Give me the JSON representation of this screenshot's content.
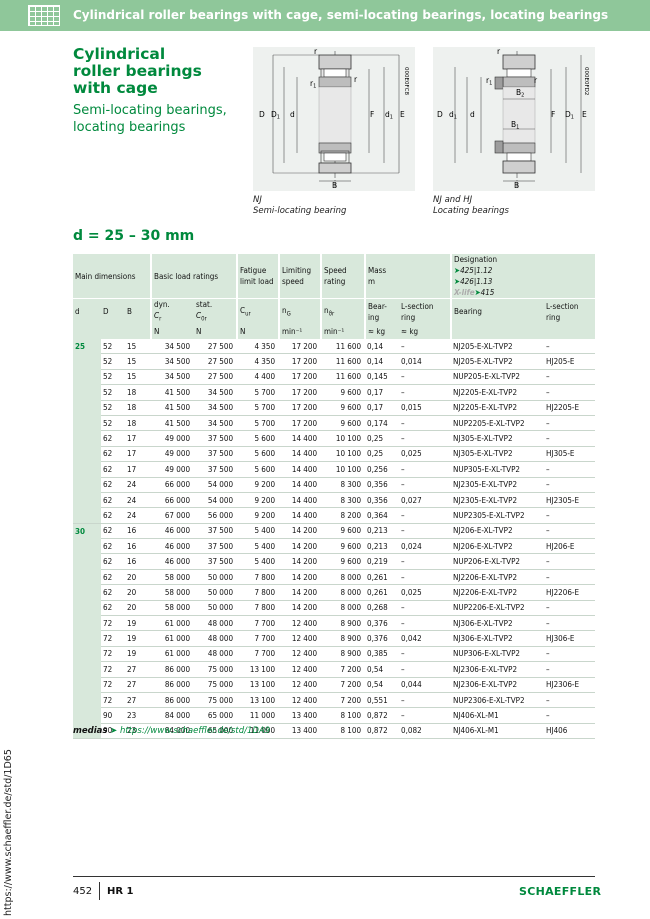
{
  "header": {
    "title": "Cylindrical roller bearings with cage, semi-locating bearings, locating bearings"
  },
  "title": "Cylindrical roller bearings with cage",
  "title_lines": [
    "Cylindrical",
    "roller bearings",
    "with cage"
  ],
  "subtitle_lines": [
    "Semi-locating bearings,",
    "locating bearings"
  ],
  "figures": [
    {
      "code": "000E0FC8",
      "caption_type": "NJ",
      "caption_desc": "Semi-locating bearing",
      "labels": {
        "r_top": "r",
        "r1": "r1",
        "r_right": "r",
        "D": "D",
        "D1": "D1",
        "d": "d",
        "F": "F",
        "d1": "d1",
        "E": "E",
        "B": "B"
      }
    },
    {
      "code": "000E0FD2",
      "caption_type": "NJ and HJ",
      "caption_desc": "Locating bearings",
      "labels": {
        "r_top": "r",
        "r1": "r1",
        "r_right": "r",
        "B2": "B2",
        "B1": "B1",
        "D": "D",
        "d1": "d1",
        "d": "d",
        "F": "F",
        "D1": "D1",
        "E": "E",
        "B": "B"
      }
    }
  ],
  "section_title": "d = 25 – 30 mm",
  "table": {
    "groups": {
      "main_dimensions": "Main dimensions",
      "basic_load": "Basic load ratings",
      "fatigue": "Fatigue limit load",
      "limiting": "Limiting speed",
      "speed_rating": "Speed rating",
      "mass": "Mass",
      "mass_sub": "m",
      "designation": "Designation",
      "desig_425": "425",
      "desig_425b": "1.12",
      "desig_426": "426",
      "desig_426b": "1.13",
      "xlife": "X-life",
      "desig_415": "415"
    },
    "subheaders": {
      "d": "d",
      "D": "D",
      "B": "B",
      "dyn": "dyn.",
      "dyn_sym": "Cr",
      "stat": "stat.",
      "stat_sym": "C0r",
      "cur": "Cur",
      "ng": "nG",
      "nb": "nϑr",
      "bearing_mass": "Bear-ing",
      "lsection_mass": "L-section ring",
      "bearing": "Bearing",
      "lsection": "L-section ring"
    },
    "units": {
      "N1": "N",
      "N2": "N",
      "N3": "N",
      "min1": "min⁻¹",
      "min2": "min⁻¹",
      "kg1": "≈ kg",
      "kg2": "≈ kg"
    },
    "rows": [
      {
        "d": "25",
        "D": "52",
        "B": "15",
        "Cr": "34 500",
        "C0r": "27 500",
        "Cur": "4 350",
        "nG": "17 200",
        "nr": "11 600",
        "m_b": "0,14",
        "m_l": "–",
        "bearing": "NJ205-E-XL-TVP2",
        "ring": "–"
      },
      {
        "d": "",
        "D": "52",
        "B": "15",
        "Cr": "34 500",
        "C0r": "27 500",
        "Cur": "4 350",
        "nG": "17 200",
        "nr": "11 600",
        "m_b": "0,14",
        "m_l": "0,014",
        "bearing": "NJ205-E-XL-TVP2",
        "ring": "HJ205-E"
      },
      {
        "d": "",
        "D": "52",
        "B": "15",
        "Cr": "34 500",
        "C0r": "27 500",
        "Cur": "4 400",
        "nG": "17 200",
        "nr": "11 600",
        "m_b": "0,145",
        "m_l": "–",
        "bearing": "NUP205-E-XL-TVP2",
        "ring": "–"
      },
      {
        "d": "",
        "D": "52",
        "B": "18",
        "Cr": "41 500",
        "C0r": "34 500",
        "Cur": "5 700",
        "nG": "17 200",
        "nr": "9 600",
        "m_b": "0,17",
        "m_l": "–",
        "bearing": "NJ2205-E-XL-TVP2",
        "ring": "–"
      },
      {
        "d": "",
        "D": "52",
        "B": "18",
        "Cr": "41 500",
        "C0r": "34 500",
        "Cur": "5 700",
        "nG": "17 200",
        "nr": "9 600",
        "m_b": "0,17",
        "m_l": "0,015",
        "bearing": "NJ2205-E-XL-TVP2",
        "ring": "HJ2205-E"
      },
      {
        "d": "",
        "D": "52",
        "B": "18",
        "Cr": "41 500",
        "C0r": "34 500",
        "Cur": "5 700",
        "nG": "17 200",
        "nr": "9 600",
        "m_b": "0,174",
        "m_l": "–",
        "bearing": "NUP2205-E-XL-TVP2",
        "ring": "–"
      },
      {
        "d": "",
        "D": "62",
        "B": "17",
        "Cr": "49 000",
        "C0r": "37 500",
        "Cur": "5 600",
        "nG": "14 400",
        "nr": "10 100",
        "m_b": "0,25",
        "m_l": "–",
        "bearing": "NJ305-E-XL-TVP2",
        "ring": "–"
      },
      {
        "d": "",
        "D": "62",
        "B": "17",
        "Cr": "49 000",
        "C0r": "37 500",
        "Cur": "5 600",
        "nG": "14 400",
        "nr": "10 100",
        "m_b": "0,25",
        "m_l": "0,025",
        "bearing": "NJ305-E-XL-TVP2",
        "ring": "HJ305-E"
      },
      {
        "d": "",
        "D": "62",
        "B": "17",
        "Cr": "49 000",
        "C0r": "37 500",
        "Cur": "5 600",
        "nG": "14 400",
        "nr": "10 100",
        "m_b": "0,256",
        "m_l": "–",
        "bearing": "NUP305-E-XL-TVP2",
        "ring": "–"
      },
      {
        "d": "",
        "D": "62",
        "B": "24",
        "Cr": "66 000",
        "C0r": "54 000",
        "Cur": "9 200",
        "nG": "14 400",
        "nr": "8 300",
        "m_b": "0,356",
        "m_l": "–",
        "bearing": "NJ2305-E-XL-TVP2",
        "ring": "–"
      },
      {
        "d": "",
        "D": "62",
        "B": "24",
        "Cr": "66 000",
        "C0r": "54 000",
        "Cur": "9 200",
        "nG": "14 400",
        "nr": "8 300",
        "m_b": "0,356",
        "m_l": "0,027",
        "bearing": "NJ2305-E-XL-TVP2",
        "ring": "HJ2305-E"
      },
      {
        "d": "",
        "D": "62",
        "B": "24",
        "Cr": "67 000",
        "C0r": "56 000",
        "Cur": "9 200",
        "nG": "14 400",
        "nr": "8 200",
        "m_b": "0,364",
        "m_l": "–",
        "bearing": "NUP2305-E-XL-TVP2",
        "ring": "–"
      },
      {
        "d": "30",
        "D": "62",
        "B": "16",
        "Cr": "46 000",
        "C0r": "37 500",
        "Cur": "5 400",
        "nG": "14 200",
        "nr": "9 600",
        "m_b": "0,213",
        "m_l": "–",
        "bearing": "NJ206-E-XL-TVP2",
        "ring": "–"
      },
      {
        "d": "",
        "D": "62",
        "B": "16",
        "Cr": "46 000",
        "C0r": "37 500",
        "Cur": "5 400",
        "nG": "14 200",
        "nr": "9 600",
        "m_b": "0,213",
        "m_l": "0,024",
        "bearing": "NJ206-E-XL-TVP2",
        "ring": "HJ206-E"
      },
      {
        "d": "",
        "D": "62",
        "B": "16",
        "Cr": "46 000",
        "C0r": "37 500",
        "Cur": "5 400",
        "nG": "14 200",
        "nr": "9 600",
        "m_b": "0,219",
        "m_l": "–",
        "bearing": "NUP206-E-XL-TVP2",
        "ring": "–"
      },
      {
        "d": "",
        "D": "62",
        "B": "20",
        "Cr": "58 000",
        "C0r": "50 000",
        "Cur": "7 800",
        "nG": "14 200",
        "nr": "8 000",
        "m_b": "0,261",
        "m_l": "–",
        "bearing": "NJ2206-E-XL-TVP2",
        "ring": "–"
      },
      {
        "d": "",
        "D": "62",
        "B": "20",
        "Cr": "58 000",
        "C0r": "50 000",
        "Cur": "7 800",
        "nG": "14 200",
        "nr": "8 000",
        "m_b": "0,261",
        "m_l": "0,025",
        "bearing": "NJ2206-E-XL-TVP2",
        "ring": "HJ2206-E"
      },
      {
        "d": "",
        "D": "62",
        "B": "20",
        "Cr": "58 000",
        "C0r": "50 000",
        "Cur": "7 800",
        "nG": "14 200",
        "nr": "8 000",
        "m_b": "0,268",
        "m_l": "–",
        "bearing": "NUP2206-E-XL-TVP2",
        "ring": "–"
      },
      {
        "d": "",
        "D": "72",
        "B": "19",
        "Cr": "61 000",
        "C0r": "48 000",
        "Cur": "7 700",
        "nG": "12 400",
        "nr": "8 900",
        "m_b": "0,376",
        "m_l": "–",
        "bearing": "NJ306-E-XL-TVP2",
        "ring": "–"
      },
      {
        "d": "",
        "D": "72",
        "B": "19",
        "Cr": "61 000",
        "C0r": "48 000",
        "Cur": "7 700",
        "nG": "12 400",
        "nr": "8 900",
        "m_b": "0,376",
        "m_l": "0,042",
        "bearing": "NJ306-E-XL-TVP2",
        "ring": "HJ306-E"
      },
      {
        "d": "",
        "D": "72",
        "B": "19",
        "Cr": "61 000",
        "C0r": "48 000",
        "Cur": "7 700",
        "nG": "12 400",
        "nr": "8 900",
        "m_b": "0,385",
        "m_l": "–",
        "bearing": "NUP306-E-XL-TVP2",
        "ring": "–"
      },
      {
        "d": "",
        "D": "72",
        "B": "27",
        "Cr": "86 000",
        "C0r": "75 000",
        "Cur": "13 100",
        "nG": "12 400",
        "nr": "7 200",
        "m_b": "0,54",
        "m_l": "–",
        "bearing": "NJ2306-E-XL-TVP2",
        "ring": "–"
      },
      {
        "d": "",
        "D": "72",
        "B": "27",
        "Cr": "86 000",
        "C0r": "75 000",
        "Cur": "13 100",
        "nG": "12 400",
        "nr": "7 200",
        "m_b": "0,54",
        "m_l": "0,044",
        "bearing": "NJ2306-E-XL-TVP2",
        "ring": "HJ2306-E"
      },
      {
        "d": "",
        "D": "72",
        "B": "27",
        "Cr": "86 000",
        "C0r": "75 000",
        "Cur": "13 100",
        "nG": "12 400",
        "nr": "7 200",
        "m_b": "0,551",
        "m_l": "–",
        "bearing": "NUP2306-E-XL-TVP2",
        "ring": "–"
      },
      {
        "d": "",
        "D": "90",
        "B": "23",
        "Cr": "84 000",
        "C0r": "65 000",
        "Cur": "11 000",
        "nG": "13 400",
        "nr": "8 100",
        "m_b": "0,872",
        "m_l": "–",
        "bearing": "NJ406-XL-M1",
        "ring": "–"
      },
      {
        "d": "",
        "D": "90",
        "B": "23",
        "Cr": "84 000",
        "C0r": "65 000",
        "Cur": "11 000",
        "nG": "13 400",
        "nr": "8 100",
        "m_b": "0,872",
        "m_l": "0,082",
        "bearing": "NJ406-XL-M1",
        "ring": "HJ406"
      }
    ]
  },
  "medias": {
    "label": "medias",
    "url": "https://www.schaeffler.de/std/1DA9"
  },
  "side_url": "https://www.schaeffler.de/std/1D65",
  "footer": {
    "page": "452",
    "section": "HR 1",
    "brand": "SCHAEFFLER"
  },
  "colors": {
    "accent_green": "#00893d",
    "header_green": "#8fc79a",
    "table_header": "#d8e8db"
  }
}
